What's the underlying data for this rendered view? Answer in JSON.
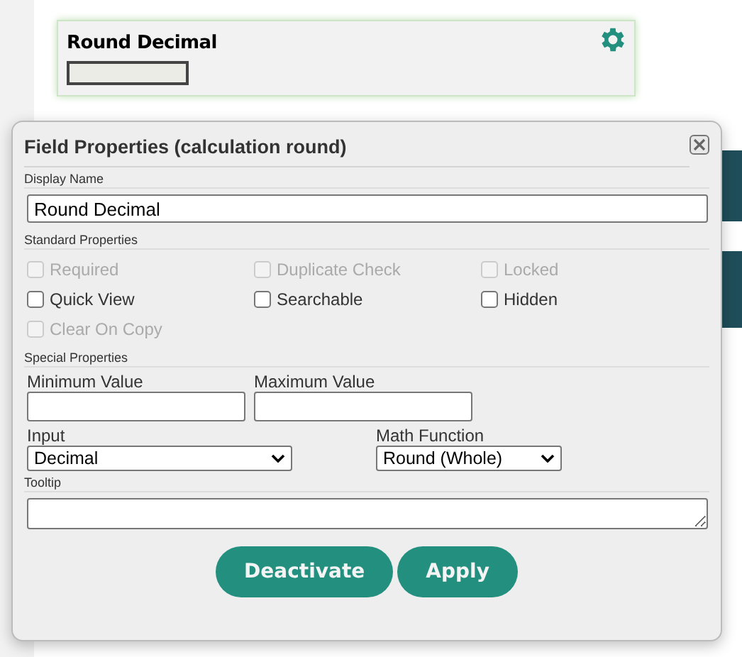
{
  "card": {
    "title": "Round Decimal"
  },
  "dialog": {
    "title": "Field Properties (calculation round)",
    "display_name": {
      "heading": "Display Name",
      "value": "Round Decimal"
    },
    "standard_properties": {
      "heading": "Standard Properties",
      "checkboxes": [
        {
          "label": "Required",
          "checked": false,
          "disabled": true
        },
        {
          "label": "Duplicate Check",
          "checked": false,
          "disabled": true
        },
        {
          "label": "Locked",
          "checked": false,
          "disabled": true
        },
        {
          "label": "Quick View",
          "checked": false,
          "disabled": false
        },
        {
          "label": "Searchable",
          "checked": false,
          "disabled": false
        },
        {
          "label": "Hidden",
          "checked": false,
          "disabled": false
        },
        {
          "label": "Clear On Copy",
          "checked": false,
          "disabled": true
        }
      ]
    },
    "special_properties": {
      "heading": "Special Properties",
      "minimum_value": {
        "label": "Minimum Value"
      },
      "maximum_value": {
        "label": "Maximum Value"
      },
      "input": {
        "label": "Input",
        "value": "Decimal"
      },
      "math_function": {
        "label": "Math Function",
        "value": "Round (Whole)"
      }
    },
    "tooltip": {
      "heading": "Tooltip"
    },
    "buttons": [
      "Deactivate",
      "Apply"
    ]
  }
}
